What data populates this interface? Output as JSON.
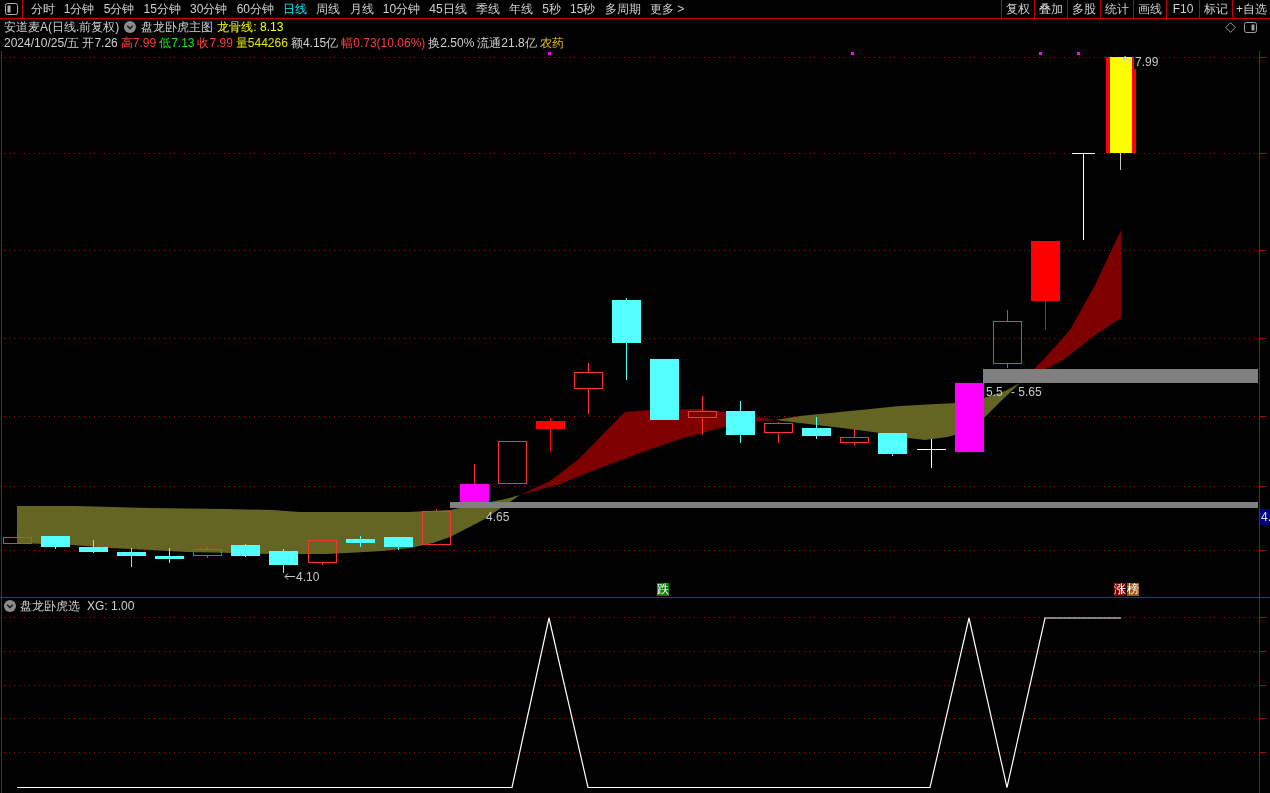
{
  "toolbar": {
    "tabs": [
      {
        "label": "分时",
        "selected": false
      },
      {
        "label": "1分钟",
        "selected": false
      },
      {
        "label": "5分钟",
        "selected": false
      },
      {
        "label": "15分钟",
        "selected": false
      },
      {
        "label": "30分钟",
        "selected": false
      },
      {
        "label": "60分钟",
        "selected": false
      },
      {
        "label": "日线",
        "selected": true
      },
      {
        "label": "周线",
        "selected": false
      },
      {
        "label": "月线",
        "selected": false
      },
      {
        "label": "10分钟",
        "selected": false
      },
      {
        "label": "45日线",
        "selected": false
      },
      {
        "label": "季线",
        "selected": false
      },
      {
        "label": "年线",
        "selected": false
      },
      {
        "label": "5秒",
        "selected": false
      },
      {
        "label": "15秒",
        "selected": false
      },
      {
        "label": "多周期",
        "selected": false
      },
      {
        "label": "更多 >",
        "selected": false
      }
    ],
    "buttons": [
      "复权",
      "叠加",
      "多股",
      "统计",
      "画线",
      "F10",
      "标记",
      "+自选"
    ]
  },
  "main_chart": {
    "title": "安道麦A(日线.前复权)",
    "indicator": {
      "name": "盘龙卧虎主图",
      "readout": "龙骨线: 8.13"
    },
    "quote": [
      {
        "text": "2024/10/25/五",
        "kind": "plain"
      },
      {
        "text": "开7.26",
        "kind": "plain"
      },
      {
        "text": "高7.99",
        "kind": "up"
      },
      {
        "text": "低7.13",
        "kind": "down"
      },
      {
        "text": "收7.99",
        "kind": "up"
      },
      {
        "text": "量544266",
        "kind": "volume"
      },
      {
        "text": "额4.15亿",
        "kind": "plain"
      },
      {
        "text": "幅0.73(10.06%)",
        "kind": "up"
      },
      {
        "text": "换2.50%",
        "kind": "plain"
      },
      {
        "text": "流通21.8亿",
        "kind": "plain"
      },
      {
        "text": "农药",
        "kind": "sector"
      }
    ],
    "price_labels": [
      "7.99",
      "4.10",
      "4.65",
      "5.5",
      "- 5.65"
    ],
    "axis_price_tag": "4.",
    "signal_tags": [
      {
        "text": "跌",
        "color": "#0f800f"
      },
      {
        "text": "涨",
        "color": "#800000"
      },
      {
        "text": "榜",
        "color": "#9a5510"
      }
    ]
  },
  "sub_chart": {
    "name": "盘龙卧虎选",
    "readout": "XG: 1.00"
  }
}
